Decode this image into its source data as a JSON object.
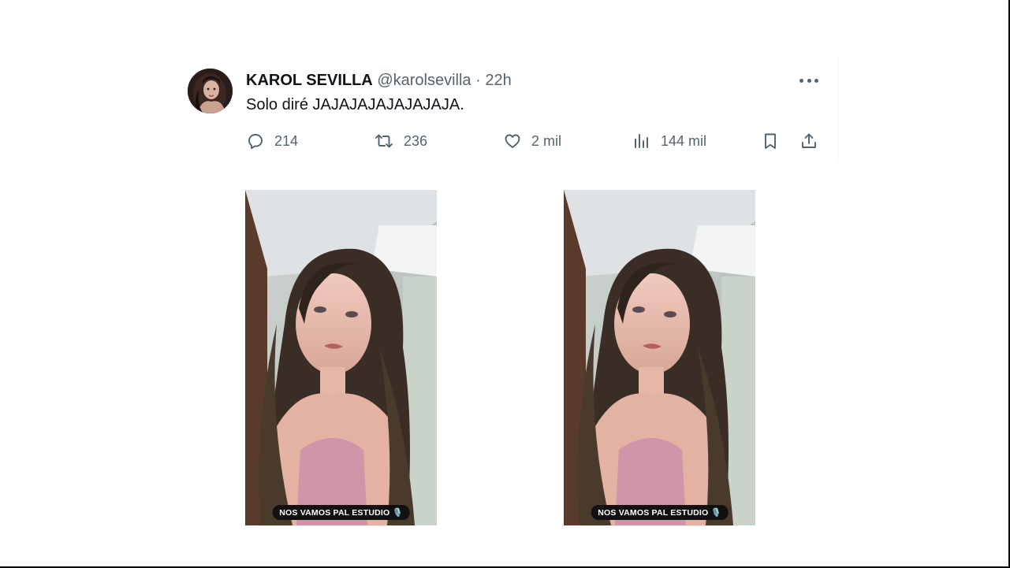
{
  "tweet": {
    "display_name": "KAROL SEVILLA",
    "handle": "@karolsevilla",
    "separator": "·",
    "time": "22h",
    "text": "Solo diré JAJAJAJAJAJAJAJA.",
    "more_icon": "more-horizontal-icon",
    "actions": {
      "replies": "214",
      "reposts": "236",
      "likes": "2 mil",
      "views": "144 mil"
    }
  },
  "photos": [
    {
      "caption": "NOS VAMOS PAL ESTUDIO 🎙️"
    },
    {
      "caption": "NOS VAMOS PAL ESTUDIO 🎙️"
    }
  ],
  "colors": {
    "text": "#0f1419",
    "secondary": "#536471",
    "divider": "#eff3f4"
  }
}
